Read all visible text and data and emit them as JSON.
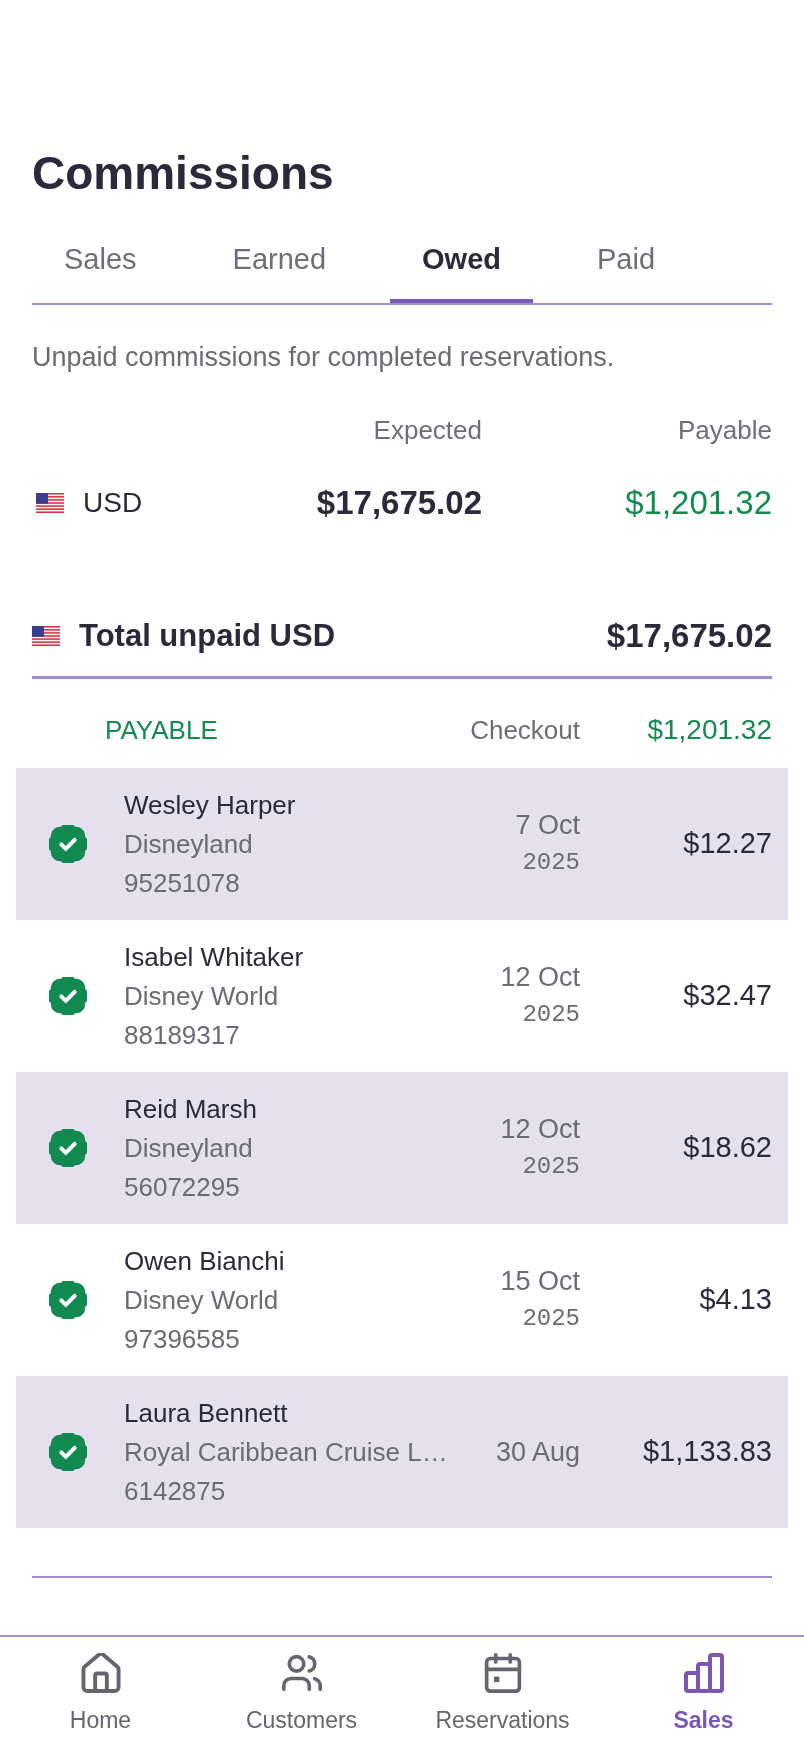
{
  "page": {
    "title": "Commissions"
  },
  "tabs": [
    {
      "label": "Sales",
      "selected": false
    },
    {
      "label": "Earned",
      "selected": false
    },
    {
      "label": "Owed",
      "selected": true
    },
    {
      "label": "Paid",
      "selected": false
    }
  ],
  "description": "Unpaid commissions for completed reservations.",
  "summary": {
    "columns": [
      "Expected",
      "Payable"
    ],
    "rows": [
      {
        "currency": "USD",
        "expected": "$17,675.02",
        "payable": "$1,201.32"
      }
    ]
  },
  "total": {
    "label": "Total unpaid USD",
    "amount": "$17,675.02"
  },
  "payable_section": {
    "heading": "PAYABLE",
    "checkout_label": "Checkout",
    "amount": "$1,201.32"
  },
  "reservations": [
    {
      "name": "Wesley Harper",
      "destination": "Disneyland",
      "number": "95251078",
      "date": "7 Oct",
      "year": "2025",
      "amount": "$12.27",
      "checked": true
    },
    {
      "name": "Isabel Whitaker",
      "destination": "Disney World",
      "number": "88189317",
      "date": "12 Oct",
      "year": "2025",
      "amount": "$32.47",
      "checked": true
    },
    {
      "name": "Reid Marsh",
      "destination": "Disneyland",
      "number": "56072295",
      "date": "12 Oct",
      "year": "2025",
      "amount": "$18.62",
      "checked": true
    },
    {
      "name": "Owen Bianchi",
      "destination": "Disney World",
      "number": "97396585",
      "date": "15 Oct",
      "year": "2025",
      "amount": "$4.13",
      "checked": true
    },
    {
      "name": "Laura Bennett",
      "destination": "Royal Caribbean Cruise L…",
      "number": "6142875",
      "date": "30 Aug",
      "amount": "$1,133.83",
      "checked": true
    }
  ],
  "bottom_nav": [
    {
      "label": "Home",
      "selected": false
    },
    {
      "label": "Customers",
      "selected": false
    },
    {
      "label": "Reservations",
      "selected": false
    },
    {
      "label": "Sales",
      "selected": true
    }
  ]
}
